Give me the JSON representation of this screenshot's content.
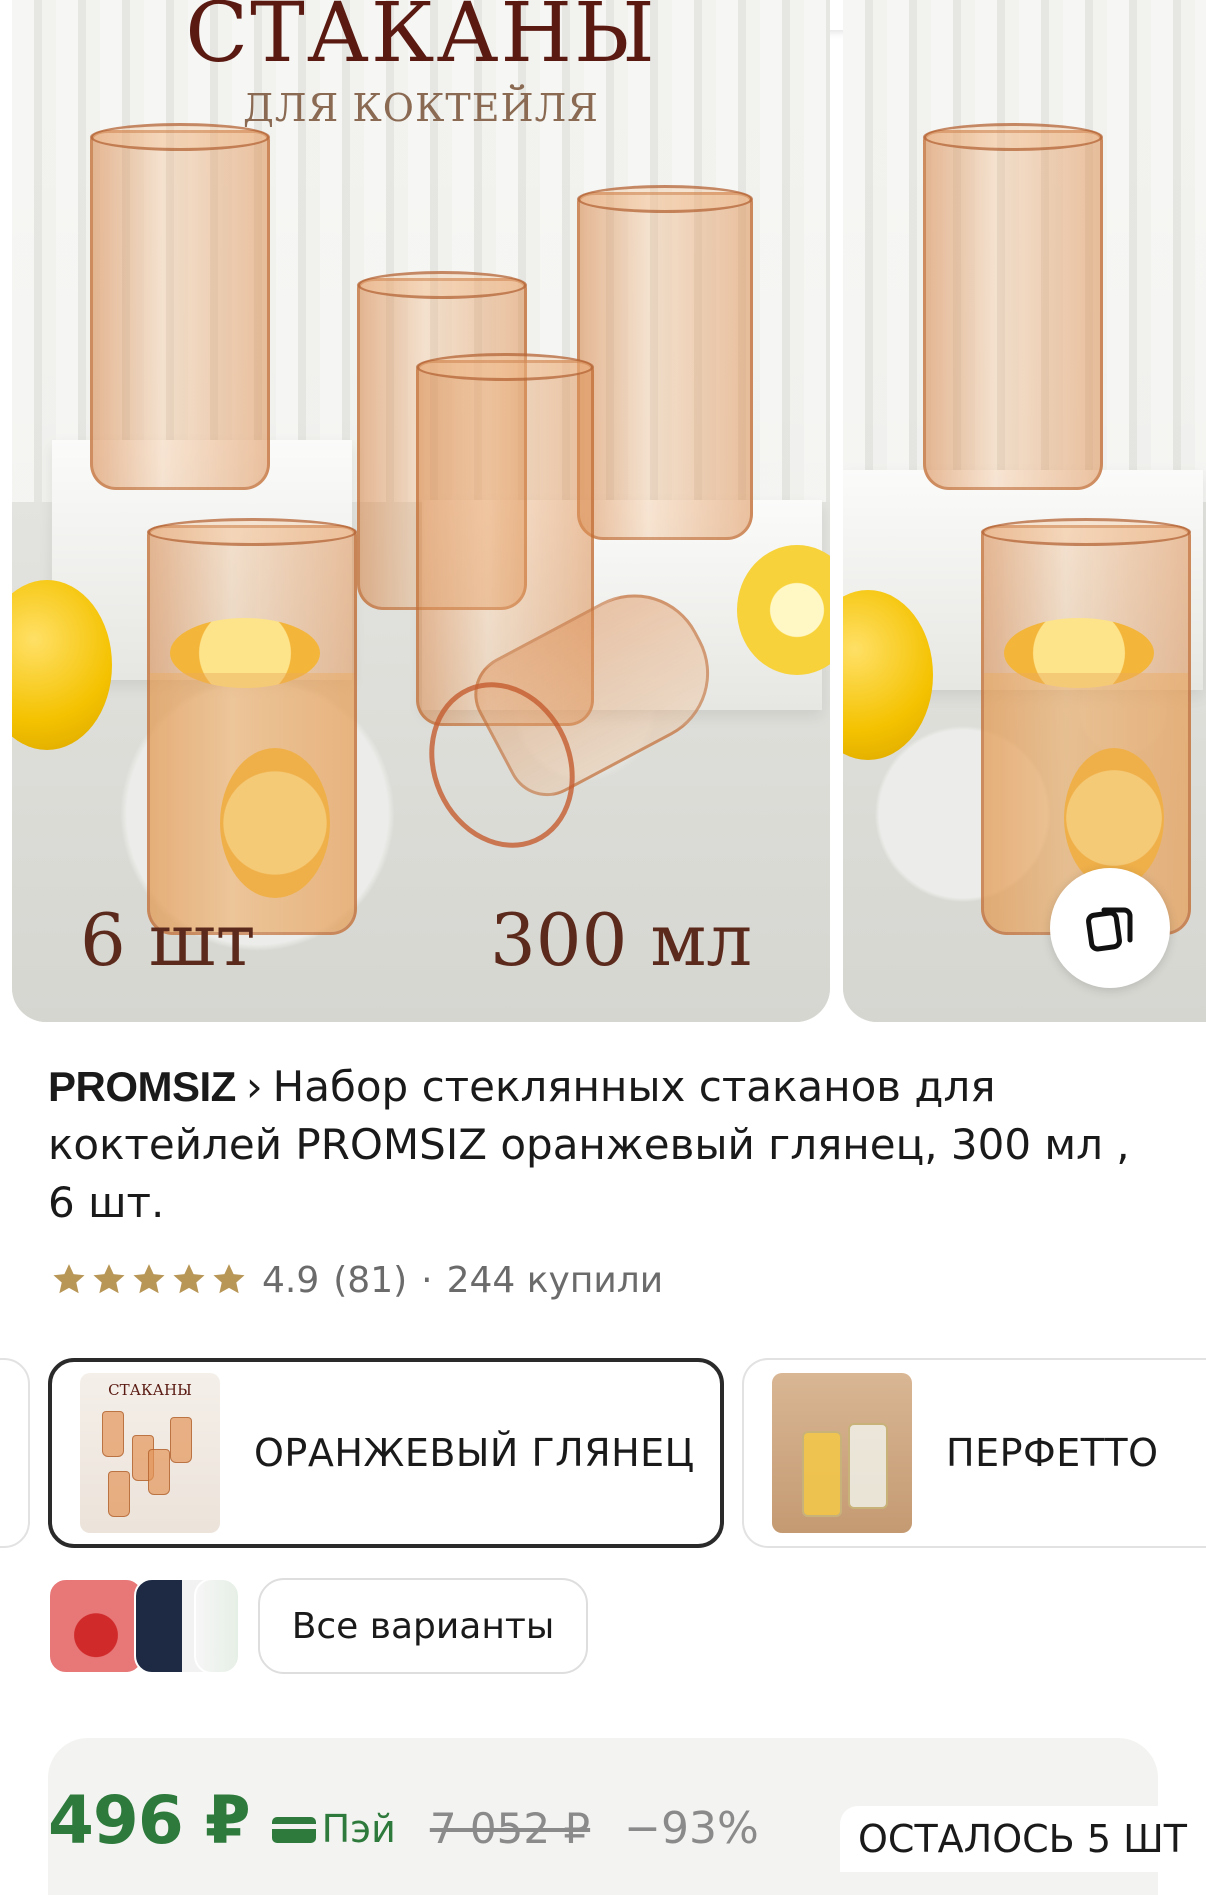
{
  "gallery": {
    "main_image": {
      "title": "СТАКАНЫ",
      "subtitle": "ДЛЯ КОКТЕЙЛЯ",
      "quantity_text": "6 шт",
      "volume_text": "300 мл"
    },
    "compare_icon": "copy-icon"
  },
  "product": {
    "brand": "PROMSIZ",
    "title": "Набор стеклянных стаканов для коктейлей PROMSIZ оранжевый глянец, 300 мл , 6 шт.",
    "rating": "4.9",
    "reviews": "(81)",
    "separator": "·",
    "purchased": "244 купили"
  },
  "variants": {
    "items": [
      {
        "label": "ОРАНЖЕВЫЙ ГЛЯНЕЦ",
        "selected": true,
        "thumb_title": "СТАКАНЫ"
      },
      {
        "label": "ПЕРФЕТТО",
        "selected": false
      }
    ],
    "all_variants_label": "Все варианты"
  },
  "price": {
    "current": "496 ₽",
    "pay_label": "Пэй",
    "old": "7 052 ₽",
    "discount": "−93%",
    "stock": "ОСТАЛОСЬ 5 ШТ"
  },
  "colors": {
    "price_green": "#2d7a3c",
    "star_gold": "#b89656",
    "selected_border": "#2a2a2a"
  }
}
